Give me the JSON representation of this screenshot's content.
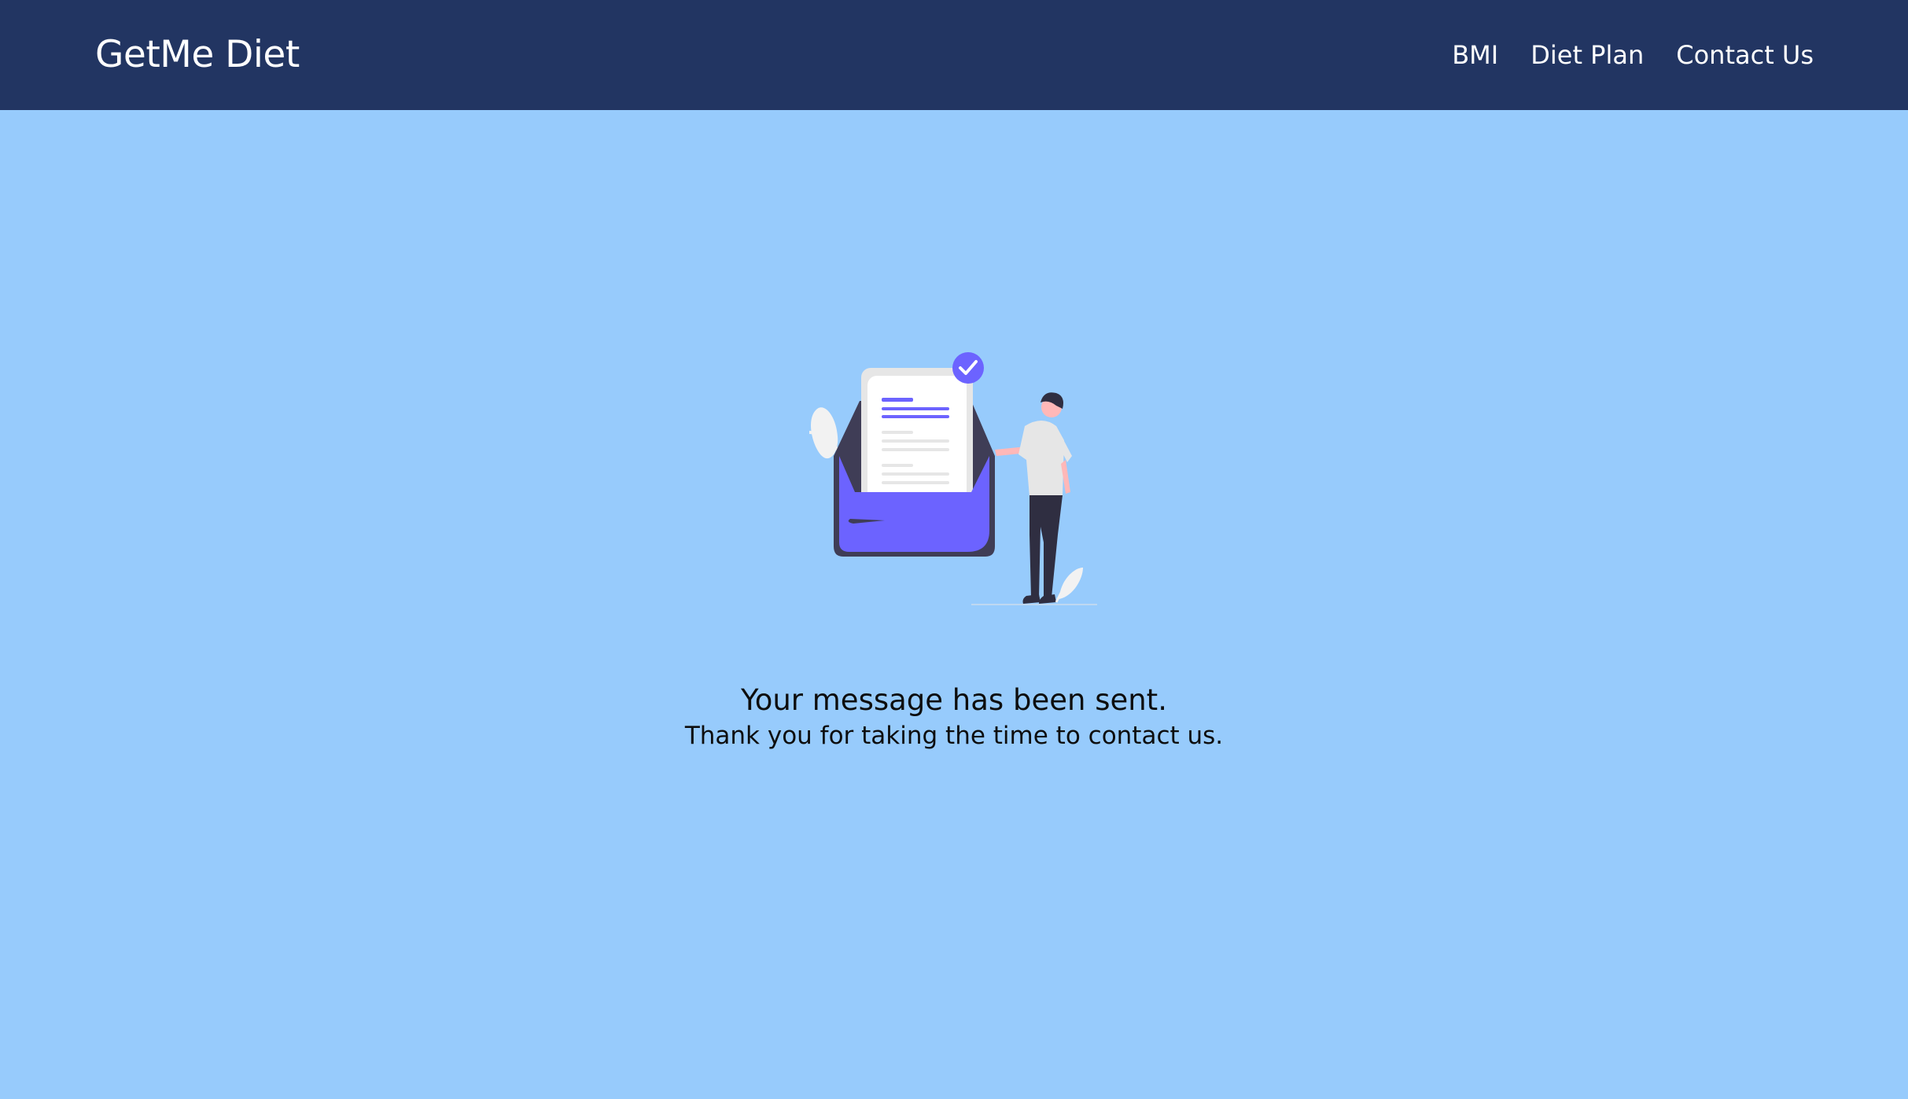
{
  "navbar": {
    "brand": "GetMe Diet",
    "links": [
      {
        "label": "BMI"
      },
      {
        "label": "Diet Plan"
      },
      {
        "label": "Contact Us"
      }
    ],
    "background_color": "#223562"
  },
  "page": {
    "background_color": "#97cbfc",
    "illustration_icon": "message-sent-illustration",
    "accent_color": "#6c63ff"
  },
  "confirmation": {
    "title": "Your message has been sent.",
    "subtitle": "Thank you for taking the time to contact us."
  }
}
